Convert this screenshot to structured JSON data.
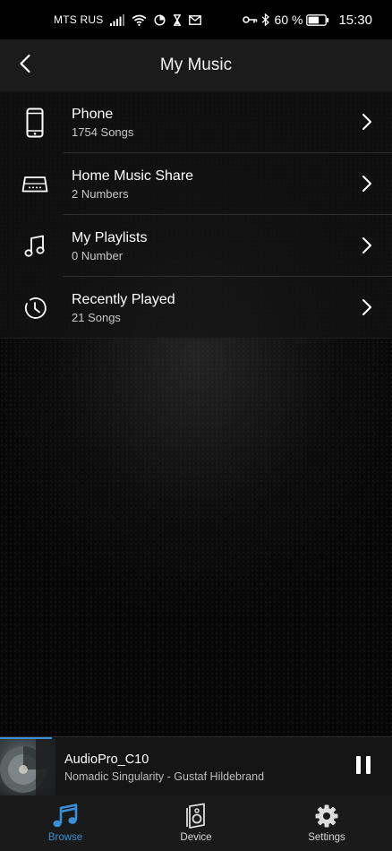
{
  "status_bar": {
    "carrier": "MTS RUS",
    "battery_percent": "60 %",
    "time": "15:30",
    "icons": [
      "signal-icon",
      "wifi-icon",
      "data-saver-icon",
      "hourglass-icon",
      "mail-icon",
      "vpn-key-icon",
      "bluetooth-icon",
      "battery-icon"
    ]
  },
  "header": {
    "title": "My Music",
    "back_icon": "back-arrow-icon"
  },
  "list": {
    "items": [
      {
        "title": "Phone",
        "subtitle": "1754  Songs",
        "icon": "phone-icon"
      },
      {
        "title": "Home Music Share",
        "subtitle": "2 Numbers",
        "icon": "router-icon"
      },
      {
        "title": "My Playlists",
        "subtitle": "0 Number",
        "icon": "music-note-icon"
      },
      {
        "title": "Recently Played",
        "subtitle": "21  Songs",
        "icon": "history-icon"
      }
    ]
  },
  "now_playing": {
    "device": "AudioPro_C10",
    "track": "Nomadic Singularity - Gustaf Hildebrand",
    "state_icon": "pause-icon"
  },
  "bottom_nav": {
    "items": [
      {
        "label": "Browse",
        "icon": "music-note-icon",
        "active": true
      },
      {
        "label": "Device",
        "icon": "speaker-icon",
        "active": false
      },
      {
        "label": "Settings",
        "icon": "gear-icon",
        "active": false
      }
    ]
  },
  "colors": {
    "accent": "#3a8fd6",
    "background": "#060606",
    "header": "#1b1b1b",
    "divider": "#2e2e2e"
  }
}
